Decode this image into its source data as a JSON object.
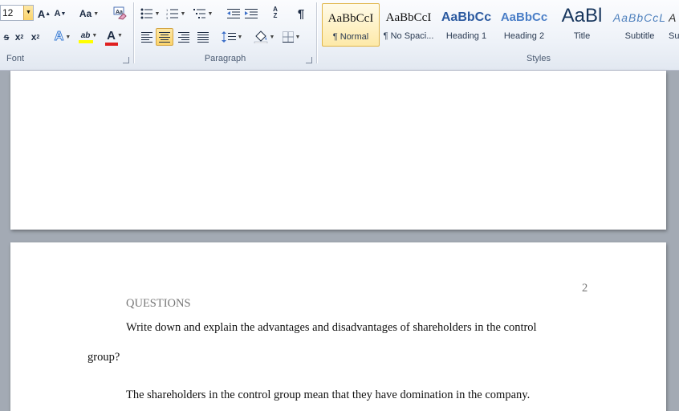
{
  "ribbon": {
    "font_group": {
      "label": "Font",
      "font_size": "12",
      "grow_icon_text": "A",
      "shrink_icon_text": "A",
      "change_case_text": "Aa",
      "strike_text": "s",
      "subscript_text": "x",
      "superscript_text": "x",
      "text_effects_text": "A",
      "highlight_text": "ab",
      "font_color_text": "A",
      "highlight_color": "#ffff00",
      "font_color": "#e02020"
    },
    "paragraph_group": {
      "label": "Paragraph",
      "pilcrow": "¶",
      "sort_text": "A Z"
    },
    "styles_group": {
      "label": "Styles",
      "styles": [
        {
          "sample": "AaBbCcI",
          "name": "¶ Normal"
        },
        {
          "sample": "AaBbCcI",
          "name": "¶ No Spaci..."
        },
        {
          "sample": "AaBbCc",
          "name": "Heading 1"
        },
        {
          "sample": "AaBbCc",
          "name": "Heading 2"
        },
        {
          "sample": "AaBl",
          "name": "Title"
        },
        {
          "sample": "AaBbCcL",
          "name": "Subtitle"
        },
        {
          "sample": "A",
          "name": "Su"
        }
      ]
    }
  },
  "document": {
    "page_number": "2",
    "heading": "QUESTIONS",
    "question_line1": "Write down and explain the advantages and disadvantages of shareholders in the control",
    "question_line2": "group?",
    "answer_line1": "The shareholders in the control group mean that they have domination in the company."
  }
}
